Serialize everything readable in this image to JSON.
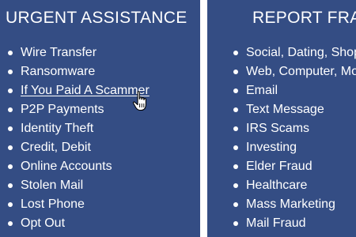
{
  "left_panel": {
    "title": "URGENT ASSISTANCE",
    "items": [
      {
        "label": "Wire Transfer"
      },
      {
        "label": "Ransomware"
      },
      {
        "label": "If You Paid A Scammer",
        "hovered": true
      },
      {
        "label": "P2P Payments"
      },
      {
        "label": "Identity Theft"
      },
      {
        "label": "Credit, Debit"
      },
      {
        "label": "Online Accounts"
      },
      {
        "label": "Stolen Mail"
      },
      {
        "label": "Lost Phone"
      },
      {
        "label": "Opt Out"
      }
    ]
  },
  "right_panel": {
    "title": "REPORT FRA",
    "items": [
      {
        "label": "Social, Dating, Shop"
      },
      {
        "label": "Web, Computer, Mo"
      },
      {
        "label": "Email"
      },
      {
        "label": "Text Message"
      },
      {
        "label": "IRS Scams"
      },
      {
        "label": "Investing"
      },
      {
        "label": "Elder Fraud"
      },
      {
        "label": "Healthcare"
      },
      {
        "label": "Mass Marketing"
      },
      {
        "label": "Mail Fraud"
      }
    ]
  },
  "colors": {
    "panel_bg": "#344d84",
    "divider": "#ffffff",
    "text": "#ffffff"
  },
  "cursor": {
    "icon": "hand-pointer-icon"
  }
}
